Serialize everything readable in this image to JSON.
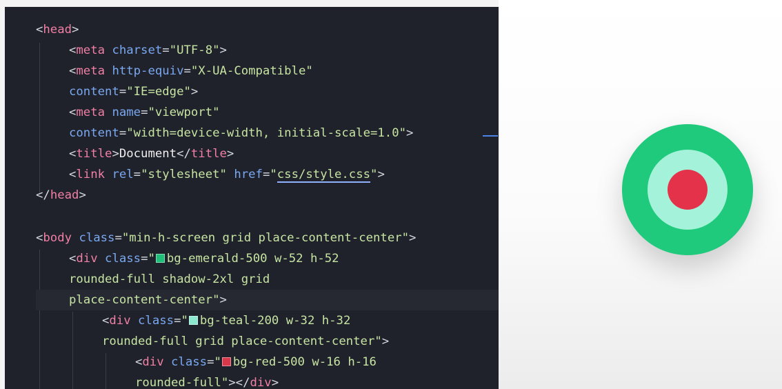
{
  "code": {
    "lines": [
      [
        "<",
        "head",
        ">"
      ],
      [
        "<",
        "meta",
        " ",
        "charset",
        "=",
        "\"UTF-8\"",
        ">"
      ],
      [
        "<",
        "meta",
        " ",
        "http-equiv",
        "=",
        "\"X-UA-Compatible\""
      ],
      [
        "content",
        "=",
        "\"IE=edge\"",
        ">"
      ],
      [
        "<",
        "meta",
        " ",
        "name",
        "=",
        "\"viewport\""
      ],
      [
        "content",
        "=",
        "\"width=device-width, initial-scale=1.0\"",
        ">"
      ],
      [
        "<",
        "title",
        ">",
        "Document",
        "</",
        "title",
        ">"
      ],
      [
        "<",
        "link",
        " ",
        "rel",
        "=",
        "\"stylesheet\"",
        " ",
        "href",
        "=",
        "\"",
        "css/style.css",
        "\"",
        ">"
      ],
      [
        "</",
        "head",
        ">"
      ],
      [],
      [
        "<",
        "body",
        " ",
        "class",
        "=",
        "\"min-h-screen grid place-content-center\"",
        ">"
      ],
      [
        "<",
        "div",
        " ",
        "class",
        "=",
        "\"",
        "bg-emerald-500 w-52 h-52"
      ],
      [
        "rounded-full shadow-2xl grid"
      ],
      [
        "place-content-center\"",
        ">"
      ],
      [
        "<",
        "div",
        " ",
        "class",
        "=",
        "\"",
        "bg-teal-200 w-32 h-32"
      ],
      [
        "rounded-full grid place-content-center\"",
        ">"
      ],
      [
        "<",
        "div",
        " ",
        "class",
        "=",
        "\"",
        "bg-red-500 w-16 h-16"
      ],
      [
        "rounded-full\"",
        "></",
        "div",
        ">"
      ]
    ]
  },
  "swatches": {
    "emerald": "#1fbf79",
    "teal": "#8be8cf",
    "red": "#d9374a"
  },
  "preview": {
    "outer_color": "#20ca7c",
    "middle_color": "#a4f2d9",
    "inner_color": "#e4324a"
  }
}
